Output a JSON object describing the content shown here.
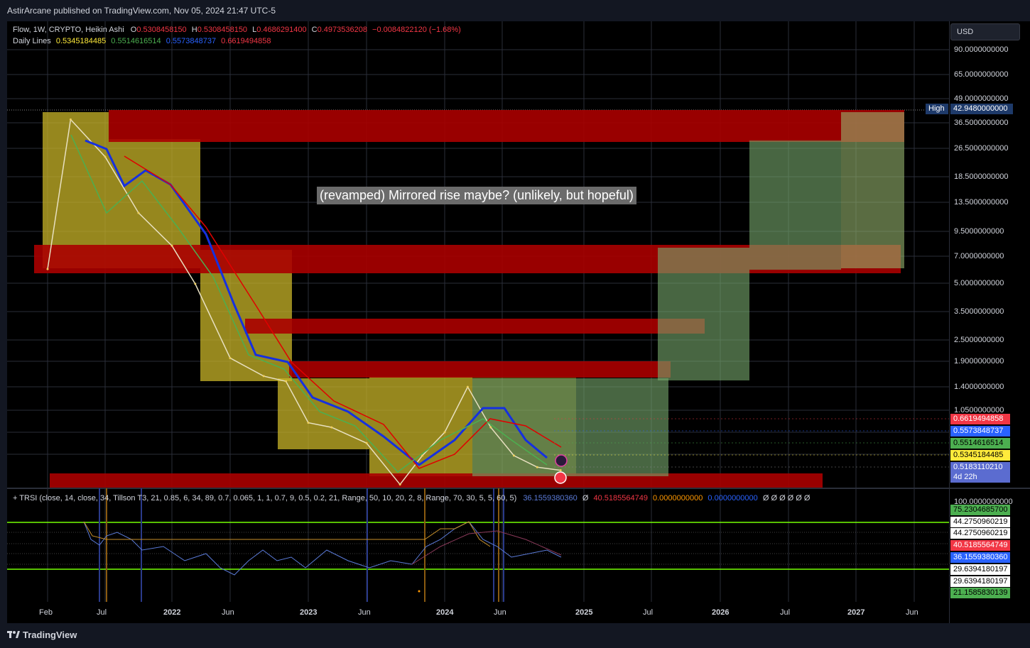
{
  "header": {
    "publisher_line": "AstirArcane published on TradingView.com, Nov 05, 2024 21:47 UTC-5"
  },
  "legend": {
    "symbol": "Flow, 1W, CRYPTO, Heikin Ashi",
    "o_label": "O",
    "o_value": "0.5308458150",
    "h_label": "H",
    "h_value": "0.5308458150",
    "l_label": "L",
    "l_value": "0.4686291400",
    "c_label": "C",
    "c_value": "0.4973536208",
    "change": "−0.0084822120 (−1.68%)",
    "daily_lines_label": "Daily Lines",
    "dl1": "0.5345184485",
    "dl2": "0.5514616514",
    "dl3": "0.5573848737",
    "dl4": "0.6619494858"
  },
  "currency_button": "USD",
  "annotation": "(revamped) Mirrored rise maybe? (unlikely, but hopeful)",
  "high_marker": {
    "label": "High",
    "value": "42.9480000000"
  },
  "price_axis": [
    "90.0000000000",
    "65.0000000000",
    "49.0000000000",
    "36.5000000000",
    "26.5000000000",
    "18.5000000000",
    "13.5000000000",
    "9.5000000000",
    "7.0000000000",
    "5.0000000000",
    "3.5000000000",
    "2.5000000000",
    "1.9000000000",
    "1.4000000000",
    "1.0500000000"
  ],
  "price_tags": [
    {
      "value": "0.6619494858",
      "bg": "#f23645",
      "fg": "#ffffff"
    },
    {
      "value": "0.5573848737",
      "bg": "#2962ff",
      "fg": "#ffffff"
    },
    {
      "value": "0.5514616514",
      "bg": "#4caf50",
      "fg": "#000000"
    },
    {
      "value": "0.5345184485",
      "bg": "#ffeb3b",
      "fg": "#000000"
    },
    {
      "value": "0.5183110210",
      "bg": "#5b6cd0",
      "fg": "#ffffff"
    }
  ],
  "countdown": "4d 22h",
  "time_axis": [
    "Feb",
    "Jul",
    "2022",
    "Jun",
    "2023",
    "Jun",
    "2024",
    "Jun",
    "2025",
    "Jul",
    "2026",
    "Jul",
    "2027",
    "Jun"
  ],
  "indicator": {
    "legend": "+ TRSI (close, 14, close, 34, Tillson T3, 21, 0.85, 6, 34, 89, 0.7, 0.065, 1, 1, 0.7, 9, 0.5, 0.2, 21, Range, 50, 10, 20, 2, 8, Range, 70, 30, 5, 5, 60, 5)",
    "v1": "36.1559380360",
    "v2": "40.5185564749",
    "v3": "0.0000000000",
    "v4": "0.0000000000",
    "nulls": "Ø    Ø  Ø  Ø  Ø  Ø",
    "axis_top": "100.0000000000",
    "tags": [
      {
        "value": "75.2304685700",
        "bg": "#4caf50",
        "fg": "#000000"
      },
      {
        "value": "44.2750960219",
        "bg": "#ffffff",
        "fg": "#000000"
      },
      {
        "value": "44.2750960219",
        "bg": "#ffffff",
        "fg": "#000000"
      },
      {
        "value": "40.5185564749",
        "bg": "#f23645",
        "fg": "#ffffff"
      },
      {
        "value": "36.1559380360",
        "bg": "#2962ff",
        "fg": "#ffffff"
      },
      {
        "value": "29.6394180197",
        "bg": "#ffffff",
        "fg": "#000000"
      },
      {
        "value": "29.6394180197",
        "bg": "#ffffff",
        "fg": "#000000"
      },
      {
        "value": "21.1585830139",
        "bg": "#4caf50",
        "fg": "#000000"
      }
    ]
  },
  "footer": {
    "brand": "TradingView"
  },
  "chart_data": {
    "type": "line",
    "title": "Flow, 1W, CRYPTO, Heikin Ashi",
    "y_scale": "log",
    "series": [
      {
        "name": "Flow",
        "x": [
          "2021-02",
          "2021-04",
          "2021-07",
          "2021-10",
          "2022-01",
          "2022-03",
          "2022-06",
          "2022-09",
          "2022-11",
          "2023-01",
          "2023-03",
          "2023-06",
          "2023-09",
          "2023-11",
          "2024-01",
          "2024-03",
          "2024-05",
          "2024-07",
          "2024-09",
          "2024-11"
        ],
        "values": [
          6.0,
          38.0,
          24.0,
          12.0,
          8.0,
          5.0,
          2.0,
          1.6,
          1.5,
          0.9,
          0.85,
          0.7,
          0.42,
          0.6,
          0.8,
          1.4,
          0.85,
          0.6,
          0.52,
          0.5
        ]
      }
    ],
    "horizontal_lines": [
      0.6619494858,
      0.5573848737,
      0.5514616514,
      0.5345184485,
      0.518311021
    ],
    "high": 42.948
  }
}
